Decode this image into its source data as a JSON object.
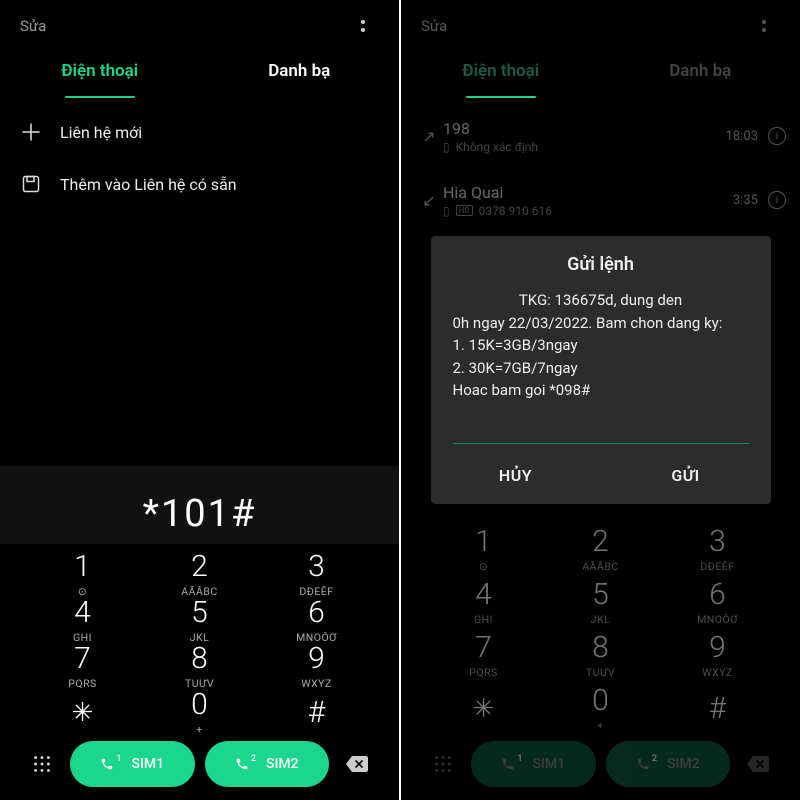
{
  "left": {
    "topbar": {
      "edit": "Sửa"
    },
    "tabs": {
      "phone": "Điện thoại",
      "contacts": "Danh bạ"
    },
    "options": {
      "new_contact": "Liên hệ mới",
      "add_existing": "Thêm vào Liên hệ có sẵn"
    },
    "dialed": "*101#",
    "keypad": {
      "k1": {
        "n": "1",
        "l": "⊙"
      },
      "k2": {
        "n": "2",
        "l": "AĂÂBC"
      },
      "k3": {
        "n": "3",
        "l": "DĐEÊF"
      },
      "k4": {
        "n": "4",
        "l": "GHI"
      },
      "k5": {
        "n": "5",
        "l": "JKL"
      },
      "k6": {
        "n": "6",
        "l": "MNOÔƠ"
      },
      "k7": {
        "n": "7",
        "l": "PQRS"
      },
      "k8": {
        "n": "8",
        "l": "TUƯV"
      },
      "k9": {
        "n": "9",
        "l": "WXYZ"
      },
      "kstar": {
        "n": "✳"
      },
      "k0": {
        "n": "0",
        "l": "+"
      },
      "khash": {
        "n": "#"
      }
    },
    "sim": {
      "sim1": "SIM1",
      "sim2": "SIM2",
      "sup1": "1",
      "sup2": "2"
    }
  },
  "right": {
    "topbar": {
      "edit": "Sửa"
    },
    "tabs": {
      "phone": "Điện thoại",
      "contacts": "Danh bạ"
    },
    "recents": [
      {
        "title": "198",
        "sub": "Không xác định",
        "time": "18:03"
      },
      {
        "title": "Hia Quai",
        "sub": "0378 910 616",
        "time": "3:35"
      }
    ],
    "dialog": {
      "title": "Gửi lệnh",
      "line1": "TKG: 136675d, dung den",
      "line2": "0h ngay 22/03/2022. Bam chon dang ky:",
      "line3": "1. 15K=3GB/3ngay",
      "line4": "2. 30K=7GB/7ngay",
      "line5": "Hoac bam goi *098#",
      "cancel": "HỦY",
      "send": "GỬI"
    },
    "keypad_same_as_left": true,
    "sim": {
      "sim1": "SIM1",
      "sim2": "SIM2",
      "sup1": "1",
      "sup2": "2"
    }
  }
}
